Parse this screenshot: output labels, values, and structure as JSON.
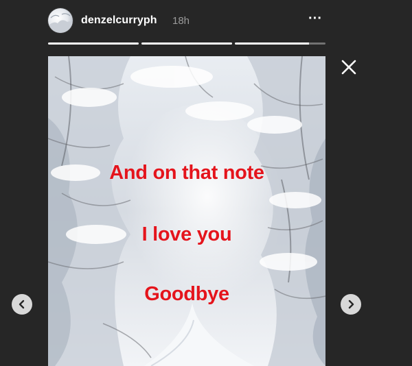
{
  "story": {
    "username": "denzelcurryph",
    "time_ago": "18h",
    "more_label": "···",
    "progress_segments": 3,
    "captions": [
      "And on that note",
      "I love you",
      "Goodbye"
    ],
    "caption_color": "#e4141c"
  },
  "icons": {
    "close": "close-icon",
    "more": "more-options-icon",
    "prev": "chevron-left-icon",
    "next": "chevron-right-icon"
  },
  "colors": {
    "background": "#262626",
    "text_primary": "#ffffff",
    "text_secondary": "#9a9a9a"
  }
}
